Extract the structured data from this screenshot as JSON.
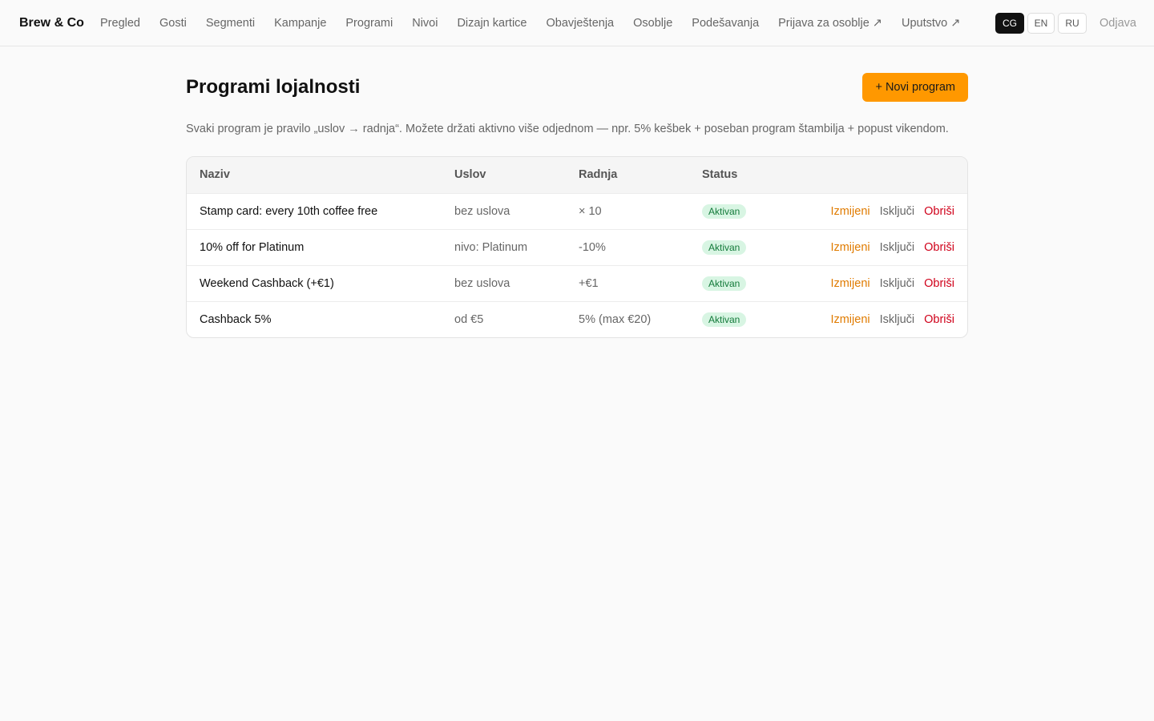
{
  "brand": "Brew & Co",
  "nav": [
    {
      "label": "Pregled",
      "name": "nav-pregled"
    },
    {
      "label": "Gosti",
      "name": "nav-gosti"
    },
    {
      "label": "Segmenti",
      "name": "nav-segmenti"
    },
    {
      "label": "Kampanje",
      "name": "nav-kampanje"
    },
    {
      "label": "Programi",
      "name": "nav-programi"
    },
    {
      "label": "Nivoi",
      "name": "nav-nivoi"
    },
    {
      "label": "Dizajn kartice",
      "name": "nav-dizajn-kartice"
    },
    {
      "label": "Obavještenja",
      "name": "nav-obavjestenja"
    },
    {
      "label": "Osoblje",
      "name": "nav-osoblje"
    },
    {
      "label": "Podešavanja",
      "name": "nav-podesavanja"
    },
    {
      "label": "Prijava za osoblje ↗",
      "name": "nav-prijava-za-osoblje"
    },
    {
      "label": "Uputstvo ↗",
      "name": "nav-uputstvo"
    }
  ],
  "languages": [
    {
      "label": "CG",
      "active": true
    },
    {
      "label": "EN",
      "active": false
    },
    {
      "label": "RU",
      "active": false
    }
  ],
  "logout_label": "Odjava",
  "page": {
    "title": "Programi lojalnosti",
    "new_button": "+ Novi program",
    "description": "Svaki program je pravilo „uslov → radnja“. Možete držati aktivno više odjednom — npr. 5% kešbek + poseban program štambilja + popust vikendom."
  },
  "table": {
    "headers": {
      "name": "Naziv",
      "condition": "Uslov",
      "action": "Radnja",
      "status": "Status"
    },
    "rows": [
      {
        "name": "Stamp card: every 10th coffee free",
        "condition": "bez uslova",
        "action": "× 10",
        "status": "Aktivan"
      },
      {
        "name": "10% off for Platinum",
        "condition": "nivo: Platinum",
        "action": "-10%",
        "status": "Aktivan"
      },
      {
        "name": "Weekend Cashback (+€1)",
        "condition": "bez uslova",
        "action": "+€1",
        "status": "Aktivan"
      },
      {
        "name": "Cashback 5%",
        "condition": "od €5",
        "action": "5% (max €20)",
        "status": "Aktivan"
      }
    ],
    "row_actions": {
      "edit": "Izmijeni",
      "disable": "Isključi",
      "delete": "Obriši"
    }
  },
  "colors": {
    "accent": "#ff9800",
    "status_active_bg": "#d8f5e3",
    "status_active_text": "#137a3a",
    "edit_link": "#e07b00",
    "delete_link": "#d0021b"
  }
}
